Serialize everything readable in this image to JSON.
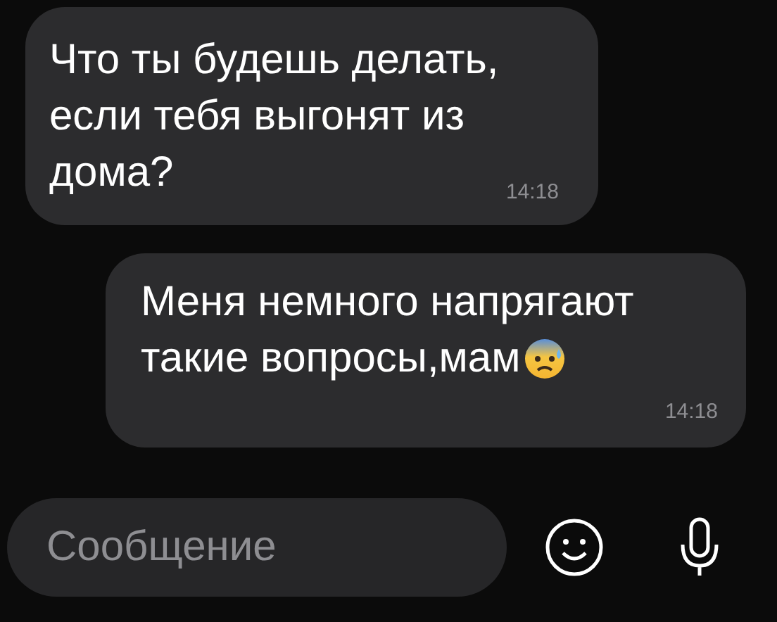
{
  "messages": [
    {
      "kind": "incoming",
      "lines": [
        "Что ты будешь делать,",
        "если тебя выгонят из",
        "дома?"
      ],
      "time": "14:18"
    },
    {
      "kind": "outgoing",
      "lines": [
        "Меня немного напрягают",
        "такие вопросы,мам"
      ],
      "time": "14:18"
    }
  ],
  "composer": {
    "placeholder": "Сообщение"
  }
}
